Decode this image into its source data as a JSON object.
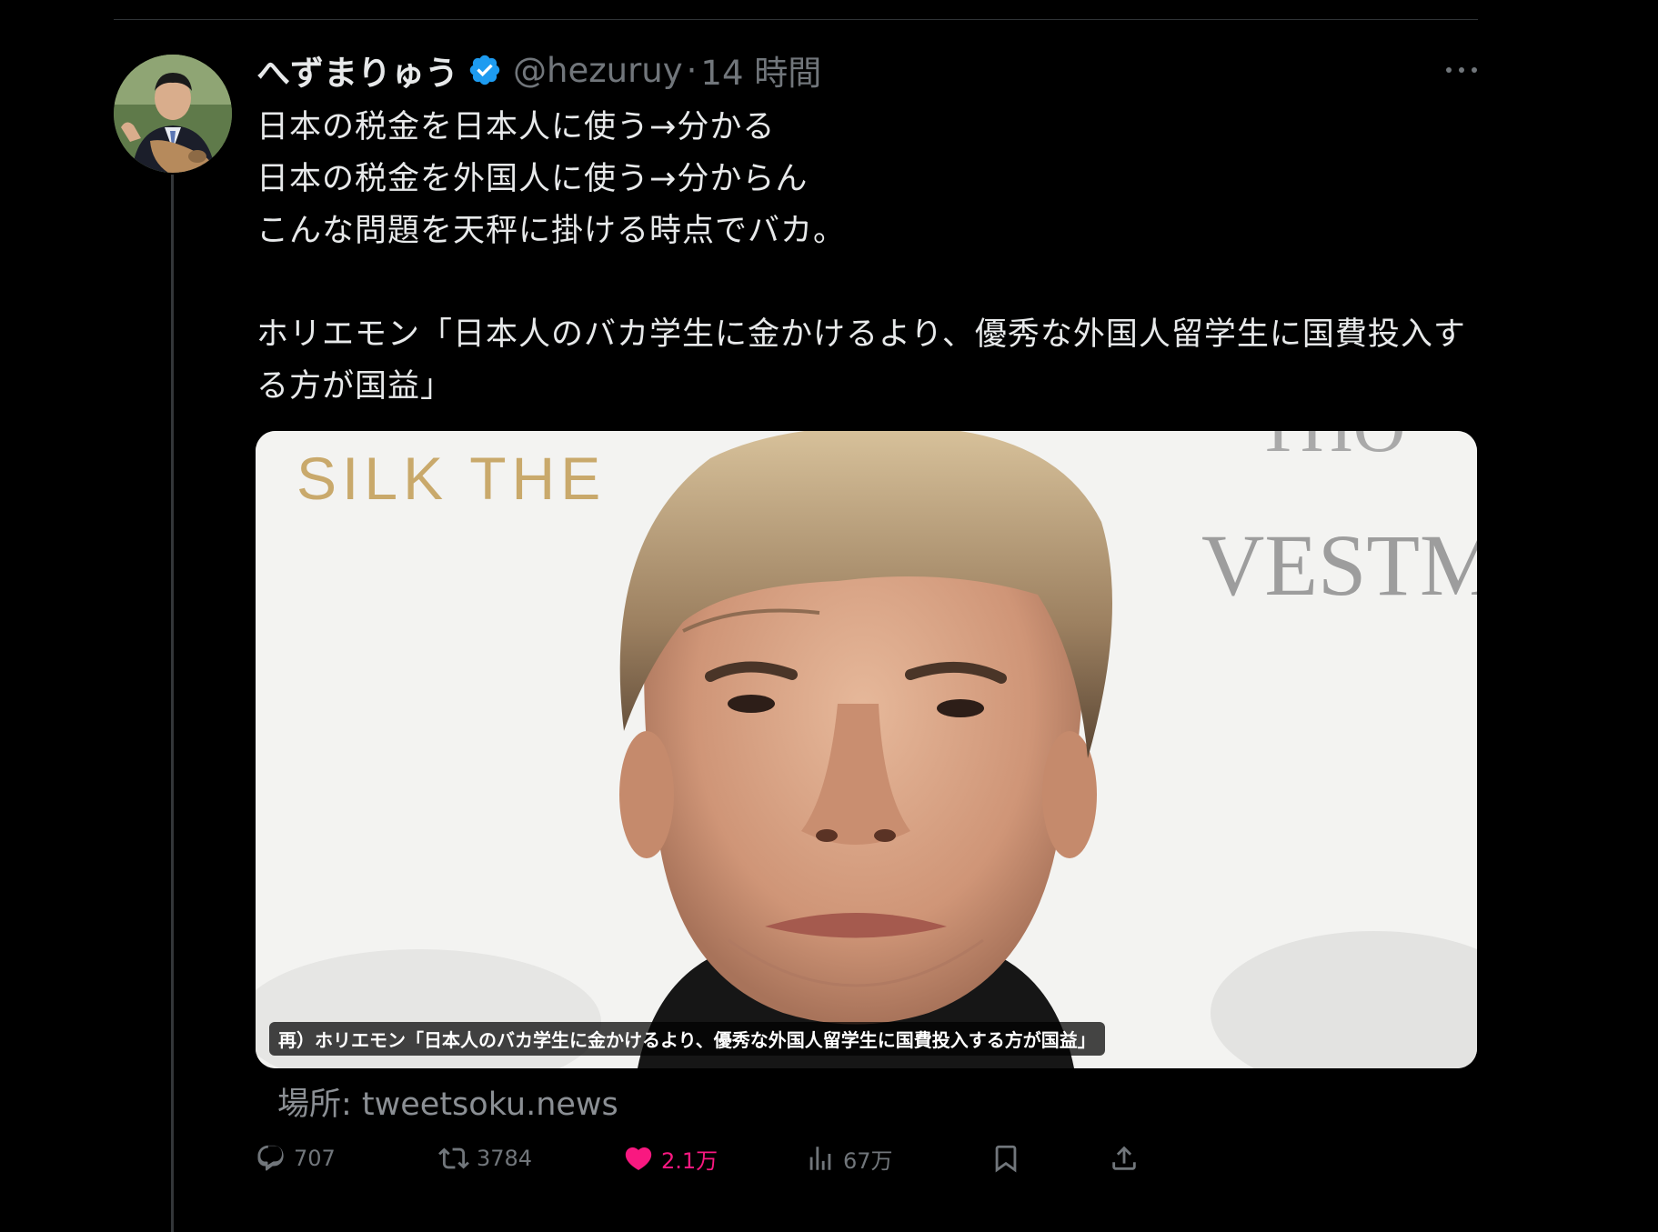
{
  "author": {
    "display_name": "へずまりゅう",
    "handle": "@hezuruy",
    "separator": "·",
    "timestamp": "14 時間",
    "verified": true
  },
  "tweet": {
    "lines": [
      "日本の税金を日本人に使う→分かる",
      "日本の税金を外国人に使う→分からん",
      "こんな問題を天秤に掛ける時点でバカ。"
    ],
    "quote": "ホリエモン「日本人のバカ学生に金かけるより、優秀な外国人留学生に国費投入する方が国益」"
  },
  "media": {
    "backdrop_text_left": "SILK THE",
    "backdrop_text_top_right": "THO",
    "backdrop_text_right": "VESTM",
    "caption": "再）ホリエモン「日本人のバカ学生に金かけるより、優秀な外国人留学生に国費投入する方が国益」"
  },
  "source": "場所: tweetsoku.news",
  "actions": {
    "replies": "707",
    "retweets": "3784",
    "likes": "2.1万",
    "views": "67万"
  },
  "colors": {
    "background": "#000000",
    "text_primary": "#e7e9ea",
    "text_secondary": "#71767b",
    "verified_blue": "#1d9bf0",
    "like_pink": "#f91880"
  },
  "icons": {
    "reply": "reply-icon",
    "retweet": "retweet-icon",
    "like": "heart-icon",
    "views": "views-icon",
    "bookmark": "bookmark-icon",
    "share": "share-icon",
    "more": "more-icon",
    "verified": "verified-badge-icon"
  }
}
